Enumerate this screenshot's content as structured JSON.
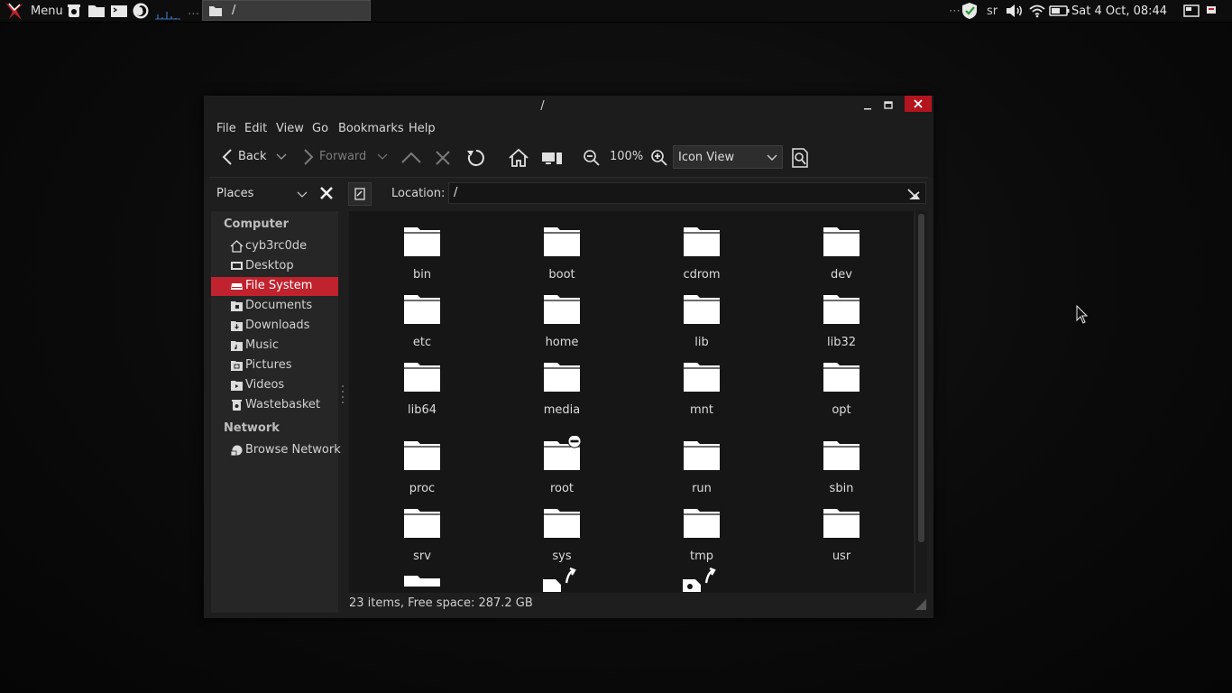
{
  "panel": {
    "menu_label": "Menu",
    "task_title": "/",
    "overflow_dots": "…",
    "tray_dots": "⋯",
    "keyboard_layout": "sr",
    "clock": "Sat  4 Oct, 08:44"
  },
  "window": {
    "title": "/",
    "menu": [
      "File",
      "Edit",
      "View",
      "Go",
      "Bookmarks",
      "Help"
    ],
    "toolbar": {
      "back_label": "Back",
      "forward_label": "Forward",
      "zoom_level": "100%",
      "view_mode": "Icon View"
    },
    "places": {
      "label": "Places",
      "location_label": "Location:",
      "location_value": "/"
    },
    "sidebar": {
      "computer_header": "Computer",
      "network_header": "Network",
      "items": [
        {
          "label": "cyb3rc0de",
          "icon": "home-icon"
        },
        {
          "label": "Desktop",
          "icon": "desktop-icon"
        },
        {
          "label": "File System",
          "icon": "drive-icon",
          "selected": true
        },
        {
          "label": "Documents",
          "icon": "folder-icon"
        },
        {
          "label": "Downloads",
          "icon": "folder-icon"
        },
        {
          "label": "Music",
          "icon": "folder-icon"
        },
        {
          "label": "Pictures",
          "icon": "folder-icon"
        },
        {
          "label": "Videos",
          "icon": "folder-icon"
        },
        {
          "label": "Wastebasket",
          "icon": "trash-icon"
        }
      ],
      "network_items": [
        {
          "label": "Browse Network",
          "icon": "network-icon"
        }
      ]
    },
    "files": [
      "bin",
      "boot",
      "cdrom",
      "dev",
      "etc",
      "home",
      "lib",
      "lib32",
      "lib64",
      "media",
      "mnt",
      "opt",
      "proc",
      "root",
      "run",
      "sbin",
      "srv",
      "sys",
      "tmp",
      "usr"
    ],
    "status": "23 items, Free space: 287.2 GB",
    "colors": {
      "accent": "#c0222e",
      "close_button": "#b3141e",
      "window_bg": "#1e1e1e",
      "content_bg": "#161616",
      "panel_bg": "#0d0d0d"
    }
  }
}
